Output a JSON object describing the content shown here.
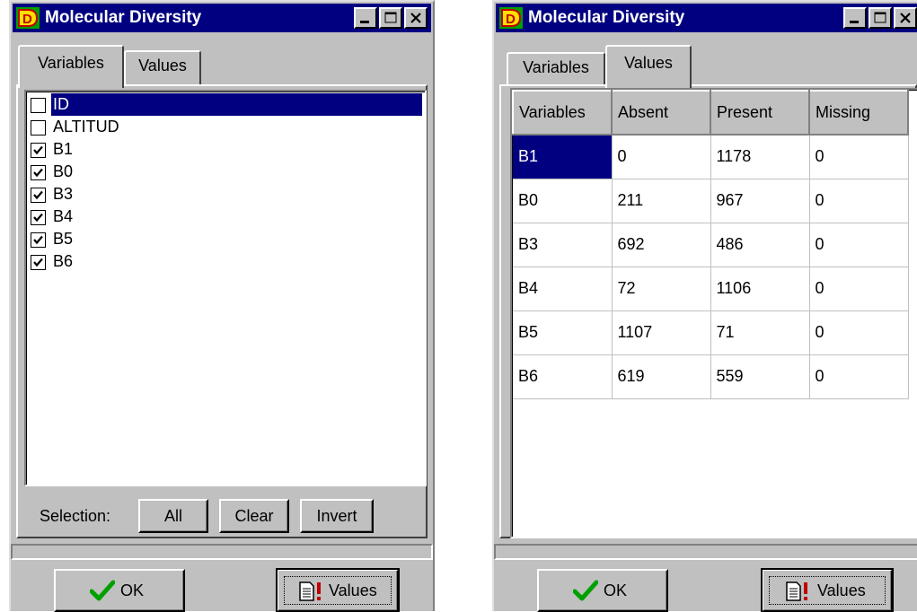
{
  "window_title": "Molecular Diversity",
  "tabs": {
    "variables": "Variables",
    "values": "Values"
  },
  "variables_list": [
    {
      "label": "ID",
      "checked": false,
      "selected": true
    },
    {
      "label": "ALTITUD",
      "checked": false,
      "selected": false
    },
    {
      "label": "B1",
      "checked": true,
      "selected": false
    },
    {
      "label": "B0",
      "checked": true,
      "selected": false
    },
    {
      "label": "B3",
      "checked": true,
      "selected": false
    },
    {
      "label": "B4",
      "checked": true,
      "selected": false
    },
    {
      "label": "B5",
      "checked": true,
      "selected": false
    },
    {
      "label": "B6",
      "checked": true,
      "selected": false
    }
  ],
  "selection": {
    "label": "Selection:",
    "all": "All",
    "clear": "Clear",
    "invert": "Invert"
  },
  "buttons": {
    "ok": "OK",
    "values": "Values"
  },
  "values_table": {
    "headers": [
      "Variables",
      "Absent",
      "Present",
      "Missing"
    ],
    "rows": [
      [
        "B1",
        "0",
        "1178",
        "0"
      ],
      [
        "B0",
        "211",
        "967",
        "0"
      ],
      [
        "B3",
        "692",
        "486",
        "0"
      ],
      [
        "B4",
        "72",
        "1106",
        "0"
      ],
      [
        "B5",
        "1107",
        "71",
        "0"
      ],
      [
        "B6",
        "619",
        "559",
        "0"
      ]
    ]
  },
  "colors": {
    "title_bar": "#000080",
    "face": "#c0c0c0",
    "selection": "#000080",
    "ok_check": "#00a000"
  }
}
